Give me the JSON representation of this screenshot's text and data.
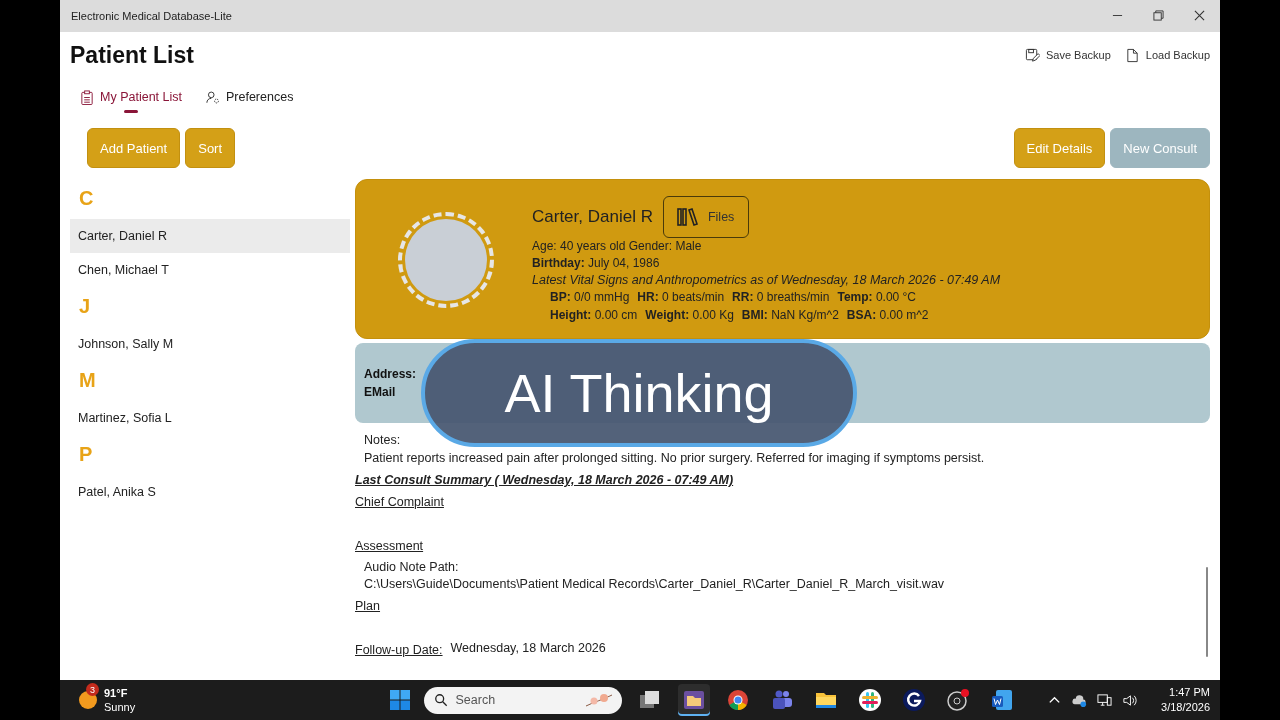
{
  "window": {
    "title": "Electronic Medical Database-Lite"
  },
  "page_title": "Patient List",
  "header_actions": [
    {
      "label": "Save Backup",
      "kind": "save"
    },
    {
      "label": "Load Backup",
      "kind": "load"
    }
  ],
  "tabs": [
    {
      "label": "My Patient List",
      "kind": "list",
      "selected": true
    },
    {
      "label": "Preferences",
      "kind": "prefs",
      "selected": false
    }
  ],
  "left_buttons": [
    "Add Patient",
    "Sort"
  ],
  "right_buttons": [
    {
      "label": "Edit Details",
      "disabled": false
    },
    {
      "label": "New Consult",
      "disabled": true
    }
  ],
  "patient_groups": [
    {
      "letter": "C",
      "patients": [
        {
          "name": "Carter, Daniel R",
          "selected": true
        },
        {
          "name": "Chen, Michael T",
          "selected": false
        }
      ]
    },
    {
      "letter": "J",
      "patients": [
        {
          "name": "Johnson, Sally M",
          "selected": false
        }
      ]
    },
    {
      "letter": "M",
      "patients": [
        {
          "name": "Martinez, Sofia L",
          "selected": false
        }
      ]
    },
    {
      "letter": "P",
      "patients": [
        {
          "name": "Patel, Anika S",
          "selected": false
        }
      ]
    }
  ],
  "patient_card": {
    "name": "Carter, Daniel R",
    "files_button": "Files",
    "age_gender": "Age: 40 years old Gender: Male",
    "birthday_label": "Birthday:",
    "birthday": "July 04, 1986",
    "vitals_heading": "Latest Vital Signs and Anthropometrics as of  Wednesday, 18 March 2026 - 07:49 AM",
    "vitals": [
      [
        {
          "label": "BP:",
          "value": "0/0 mmHg"
        },
        {
          "label": "HR:",
          "value": "0 beats/min"
        },
        {
          "label": "RR:",
          "value": "0 breaths/min"
        },
        {
          "label": "Temp:",
          "value": "0.00 °C"
        }
      ],
      [
        {
          "label": "Height:",
          "value": "0.00 cm"
        },
        {
          "label": "Weight:",
          "value": "0.00 Kg"
        },
        {
          "label": "BMI:",
          "value": "NaN Kg/m^2"
        },
        {
          "label": "BSA:",
          "value": "0.00 m^2"
        }
      ]
    ]
  },
  "contact": {
    "address_label": "Address:",
    "email_label": "EMail"
  },
  "overlay": {
    "text": "AI Thinking"
  },
  "notes": {
    "label": "Notes:",
    "text": "Patient reports increased pain after prolonged sitting. No prior surgery. Referred for imaging if symptoms persist."
  },
  "consult": {
    "title": "Last Consult Summary ( Wednesday, 18 March 2026 - 07:49 AM)",
    "sections": [
      {
        "heading": "Chief Complaint"
      },
      {
        "heading": "Assessment",
        "lines": [
          "Audio Note Path:",
          "C:\\Users\\Guide\\Documents\\Patient Medical Records\\Carter_Daniel_R\\Carter_Daniel_R_March_visit.wav"
        ]
      },
      {
        "heading": "Plan"
      }
    ],
    "follow_up_label": "Follow-up Date:",
    "follow_up": "Wednesday, 18 March 2026"
  },
  "taskbar": {
    "weather_badge": "3",
    "temperature": "91°F",
    "condition": "Sunny",
    "search_placeholder": "Search",
    "apps": [
      {
        "kind": "taskview",
        "active": false
      },
      {
        "kind": "folderapp",
        "active": true
      },
      {
        "kind": "browser",
        "active": false
      },
      {
        "kind": "people",
        "active": false
      },
      {
        "kind": "explorer",
        "active": false
      },
      {
        "kind": "hash",
        "active": false
      },
      {
        "kind": "g",
        "active": false
      },
      {
        "kind": "record",
        "active": false
      },
      {
        "kind": "doc",
        "active": false
      }
    ],
    "time": "1:47 PM",
    "date": "3/18/2026"
  }
}
